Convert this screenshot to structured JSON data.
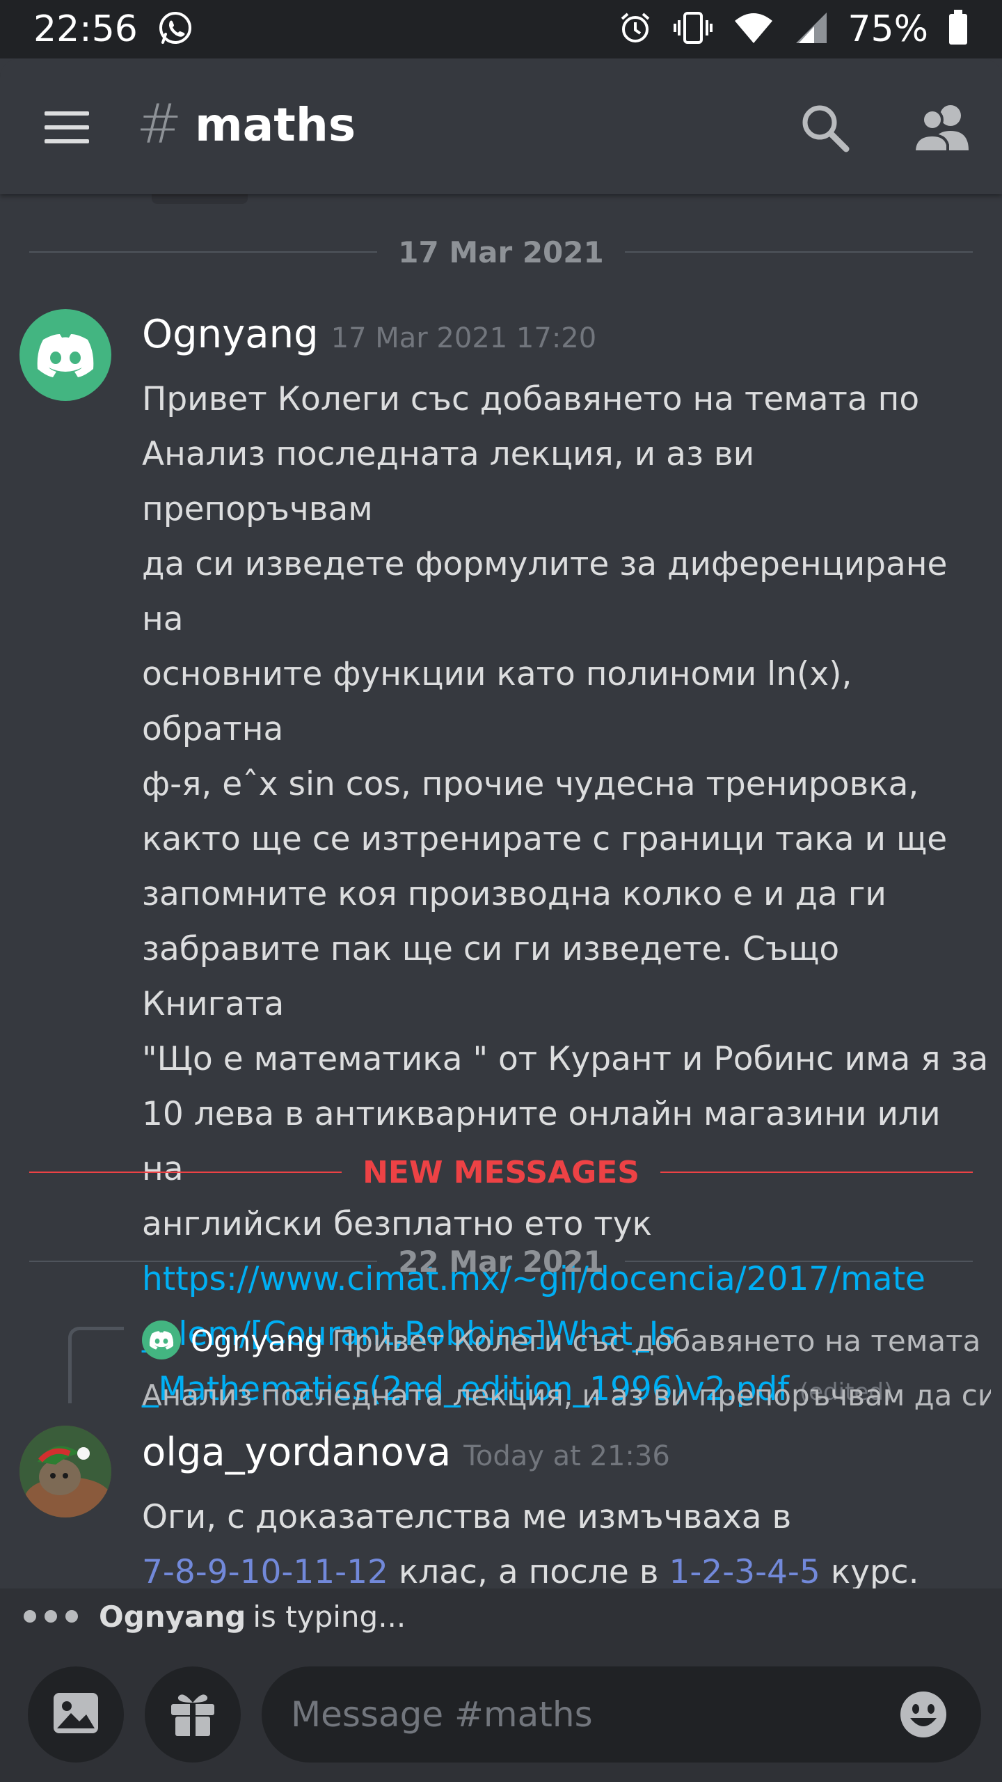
{
  "status_bar": {
    "time": "22:56",
    "battery": "75%",
    "icons": [
      "whatsapp-icon",
      "alarm-icon",
      "vibrate-icon",
      "wifi-icon",
      "signal-icon",
      "battery-icon"
    ]
  },
  "header": {
    "hash": "#",
    "channel": "maths",
    "icons": [
      "menu-icon",
      "search-icon",
      "members-icon"
    ]
  },
  "dividers": {
    "first_date": "17 Mar 2021",
    "new_messages": "NEW MESSAGES",
    "second_date": "22 Mar 2021"
  },
  "messages": [
    {
      "author": "Ognyang",
      "timestamp": "17 Mar 2021 17:20",
      "lines": [
        "Привет Колеги със добавянето на темата по",
        "Анализ последната лекция,  и аз ви препоръчвам",
        "да си изведете формулите за диференциране на",
        "основните функции като полиноми ln(x), обратна",
        "ф-я, eˆx sin cos,  прочие чудесна тренировка,",
        "както ще се изтренирате с граници така и ще",
        "запомните коя производна колко е и да ги",
        "забравите пак ще си ги изведете. Също Книгата",
        "\"Що е математика \" от Курант и Робинс има я за",
        "10 лева в антикварните онлайн магазини или на",
        "английски безплатно ето тук"
      ],
      "link_lines": [
        "https://www.cimat.mx/~gil/docencia/2017/mate",
        "_elem/[Courant,Robbins]What_Is",
        "_Mathematics(2nd_edition_1996)v2.pdf"
      ],
      "edited": "(edited)"
    },
    {
      "reply_author": "Ognyang",
      "reply_line1": "Привет Колеги със добавянето на темата по",
      "reply_line2": "Анализ последната лекция,  и аз ви препоръчвам да си",
      "author": "olga_yordanova",
      "timestamp": "Today at 21:36",
      "line1": "Оги, с доказателства ме измъчваха в",
      "line2_link1": "7-8-9-10-11-12",
      "line2_mid": " клас, а после в ",
      "line2_link2": "1-2-3-4-5",
      "line2_end": " курс."
    }
  ],
  "typing": {
    "user": "Ognyang",
    "text": "is typing..."
  },
  "composer": {
    "placeholder": "Message #maths",
    "icons": [
      "image-icon",
      "gift-icon",
      "emoji-icon"
    ]
  },
  "colors": {
    "background": "#36393f",
    "link": "#00aff4",
    "new_messages": "#ed4245",
    "discord_green": "#43b581"
  }
}
